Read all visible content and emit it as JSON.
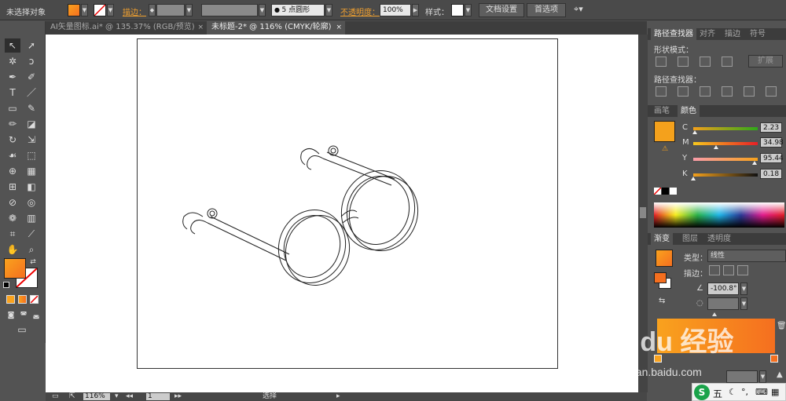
{
  "control_bar": {
    "selection_label": "未选择对象",
    "stroke_label": "描边：",
    "brush_label": "5 点圆形",
    "opacity_label": "不透明度：",
    "opacity_value": "100%",
    "style_label": "样式：",
    "doc_settings_button": "文档设置",
    "prefs_button": "首选项"
  },
  "tabs": [
    {
      "label": "AI矢量图标.ai* @ 135.37% (RGB/预览)",
      "close": "×"
    },
    {
      "label": "未标题-2* @ 116% (CMYK/轮廓)",
      "close": "×"
    }
  ],
  "pathfinder": {
    "tabs": [
      "路径查找器",
      "对齐",
      "描边",
      "符号"
    ],
    "shape_modes_label": "形状模式：",
    "expand_button": "扩展",
    "pathfinders_label": "路径查找器："
  },
  "color_panel": {
    "tabs": [
      "画笔",
      "颜色"
    ],
    "channels": [
      {
        "name": "C",
        "value": "2.23",
        "level": 0.02
      },
      {
        "name": "M",
        "value": "34.98",
        "level": 0.35
      },
      {
        "name": "Y",
        "value": "95.44",
        "level": 0.95
      },
      {
        "name": "K",
        "value": "0.18",
        "level": 0.0
      }
    ],
    "fill_color": "#f4a11c"
  },
  "gradient_panel": {
    "tabs": [
      "渐变",
      "图层",
      "透明度"
    ],
    "type_label": "类型：",
    "type_value": "线性",
    "stroke_label": "描边：",
    "angle_value": "-100.8°",
    "gradient_start": "#f9a21e",
    "gradient_end": "#f56f1f"
  },
  "status_bar": {
    "zoom": "116%",
    "page": "1",
    "mode": "选择"
  },
  "watermark": {
    "brand": "Bai du 经验",
    "url": "jingyan.baidu.com",
    "ime": "五"
  },
  "colors": {
    "ui_bg": "#535353",
    "accent_orange": "#f4a11c"
  }
}
